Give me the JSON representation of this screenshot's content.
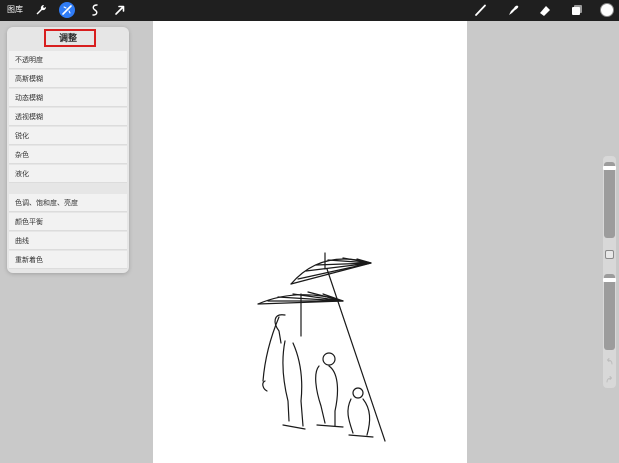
{
  "topbar": {
    "gallery_label": "图库",
    "left_icons": [
      "wrench-icon",
      "magic-wand-icon",
      "selection-icon",
      "transform-arrow-icon"
    ],
    "right_icons": [
      "brush-icon",
      "smudge-icon",
      "eraser-icon",
      "layers-icon",
      "color-icon"
    ],
    "active_tool_color": "#2f7cf6"
  },
  "adjustments_panel": {
    "title": "调整",
    "highlight_color": "#d81e1e",
    "items": [
      "不透明度",
      "高斯模糊",
      "动态模糊",
      "透视模糊",
      "锐化",
      "杂色",
      "液化",
      "色调、饱和度、亮度",
      "颜色平衡",
      "曲线",
      "重新着色"
    ]
  },
  "sidebar": {
    "brush_size": 0.95,
    "brush_opacity": 0.95
  }
}
